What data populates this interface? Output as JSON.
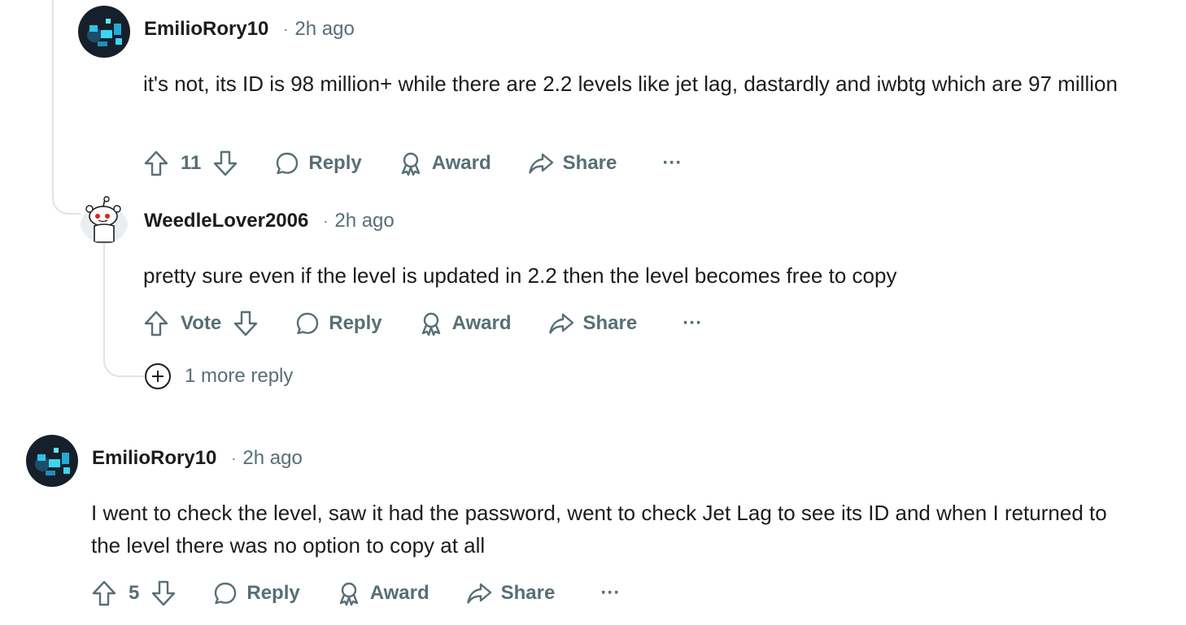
{
  "comments": [
    {
      "username": "EmilioRory10",
      "separator": "·",
      "time": "2h ago",
      "body": "it's not, its ID is 98 million+ while there are 2.2 levels like jet lag, dastardly and iwbtg which are 97 million",
      "votes": "11",
      "reply": "Reply",
      "award": "Award",
      "share": "Share",
      "more": "···"
    },
    {
      "username": "WeedleLover2006",
      "separator": "·",
      "time": "2h ago",
      "body": "pretty sure even if the level is updated in 2.2 then the level becomes free to copy",
      "votes": "Vote",
      "reply": "Reply",
      "award": "Award",
      "share": "Share",
      "more": "···",
      "more_replies": "1 more reply"
    },
    {
      "username": "EmilioRory10",
      "separator": "·",
      "time": "2h ago",
      "body": "I went to check the level, saw it had the password, went to check Jet Lag to see its ID and when I returned to the level there was no option to copy at all",
      "votes": "5",
      "reply": "Reply",
      "award": "Award",
      "share": "Share",
      "more": "···"
    }
  ],
  "icons": {
    "upvote": "arrow-up-icon",
    "downvote": "arrow-down-icon",
    "reply": "speech-bubble-icon",
    "award": "award-ribbon-icon",
    "share": "share-arrow-icon",
    "more": "ellipsis-icon",
    "expand": "plus-circle-icon"
  },
  "colors": {
    "text": "#1c1c1c",
    "muted": "#576f76",
    "thread_line": "#dfe3e6"
  }
}
